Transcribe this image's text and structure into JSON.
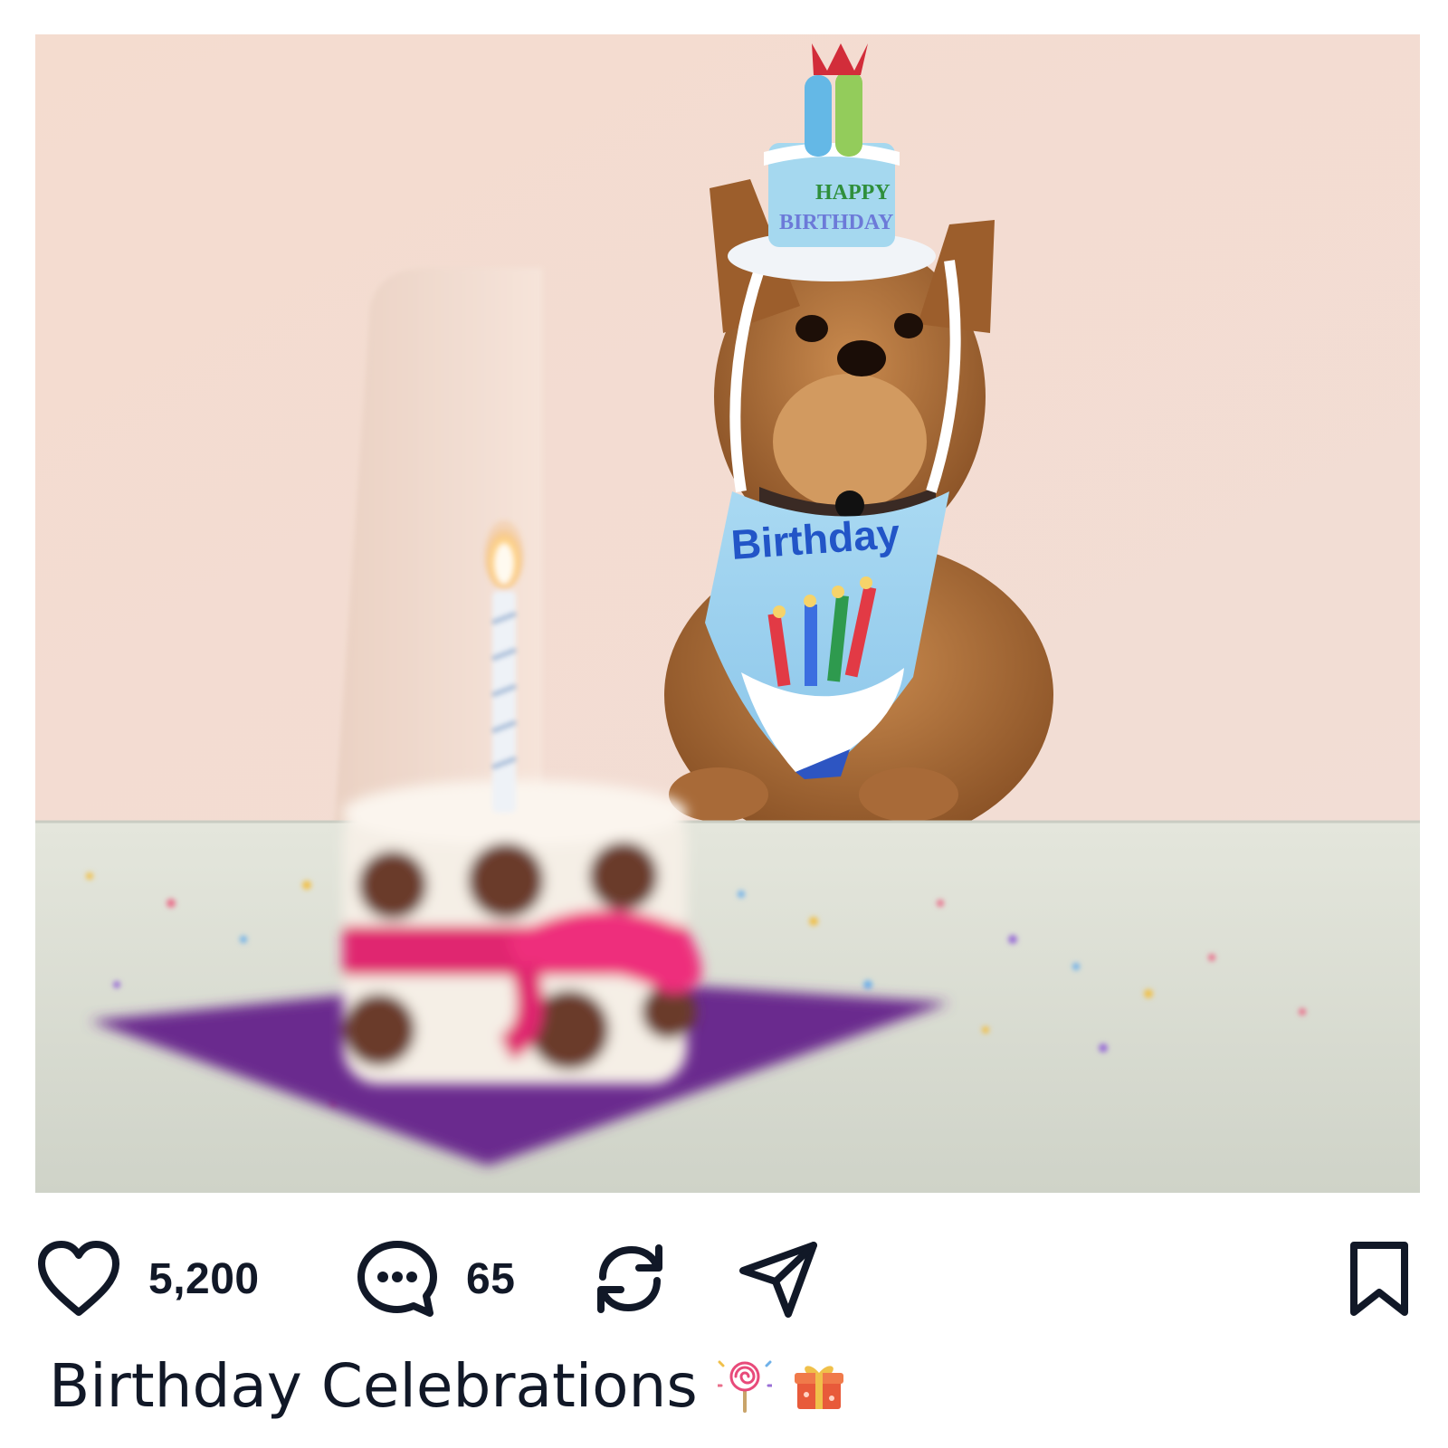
{
  "post": {
    "image": {
      "alt_subject": "dog-birthday-photo",
      "hat_text_line1": "HAPPY",
      "hat_text_line2": "BIRTHDAY",
      "bandana_text": "Birthday"
    },
    "actions": {
      "likes_count": "5,200",
      "comments_count": "65",
      "like_icon": "heart-icon",
      "comment_icon": "chat-bubble-icon",
      "repost_icon": "repost-icon",
      "share_icon": "send-icon",
      "bookmark_icon": "bookmark-icon"
    },
    "caption": {
      "text": "Birthday Celebrations",
      "emoji_1": "lollipop-icon",
      "emoji_2": "gift-icon"
    }
  },
  "colors": {
    "text": "#111827",
    "background": "#ffffff"
  }
}
